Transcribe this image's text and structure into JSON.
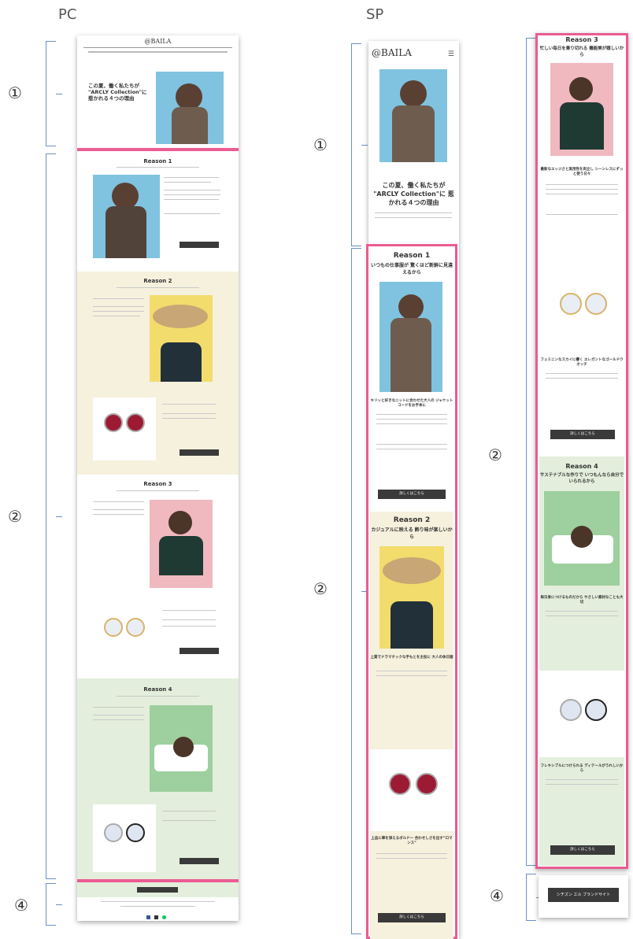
{
  "labels": {
    "pc": "PC",
    "sp": "SP"
  },
  "markers": {
    "one": "①",
    "two": "②",
    "four": "④"
  },
  "brand": "@BAILA",
  "colors": {
    "pink": "#ec5b93",
    "bracket": "#6b8fc9",
    "cream": "#f6f1dd",
    "mint": "#e3efdc",
    "button": "#3a3a3a"
  },
  "pc": {
    "hero_title": "この夏、働く私たちが \"ARCLY Collection\"に 惹かれる４つの理由",
    "reasons": [
      {
        "title": "Reason 1"
      },
      {
        "title": "Reason 2"
      },
      {
        "title": "Reason 3"
      },
      {
        "title": "Reason 4"
      }
    ]
  },
  "sp": {
    "hero_title": "この夏、働く私たちが \"ARCLY Collection\"に 惹かれる４つの理由",
    "reason1_title": "Reason 1",
    "reason1_sub": "いつもの仕事服が 驚くほど新鮮に見違えるから",
    "reason1_caption": "キリッと好きなニットに合わせた大人の ジャケットコードをお手本に",
    "reason1_button": "詳しくはこちら",
    "reason2_title": "Reason 2",
    "reason2_sub": "カジュアルに映える 飾り味が楽しいから",
    "reason2_caption": "上質でドラマチックな手もとを主役に 大人の休日服",
    "reason2_caption2": "上品に華を添えるボルドー 合わせしさを出す“ロマンス”",
    "reason2_button": "詳しくはこちら"
  },
  "sp2": {
    "reason3_title": "Reason 3",
    "reason3_sub": "忙しい毎日を乗り切れる 機能美が嬉しいから",
    "reason3_caption": "最新なエッジさと実用性を両立し シーンレスにずっと使う日々",
    "reason3_caption2": "フェミニンなスカイに響く エレガントなゴールドウオッチ",
    "reason3_button": "詳しくはこちら",
    "reason4_title": "Reason 4",
    "reason4_sub": "サステナブルな作りで いつもんなら自分でいられるから",
    "reason4_caption": "毎日身につけるものだから やさしい素材なことも大切",
    "reason4_caption2": "フレキシブルにつけられる ディテールがうれしいから",
    "reason4_button": "詳しくはこちら",
    "footer_button": "シチズン エル ブランドサイト"
  }
}
